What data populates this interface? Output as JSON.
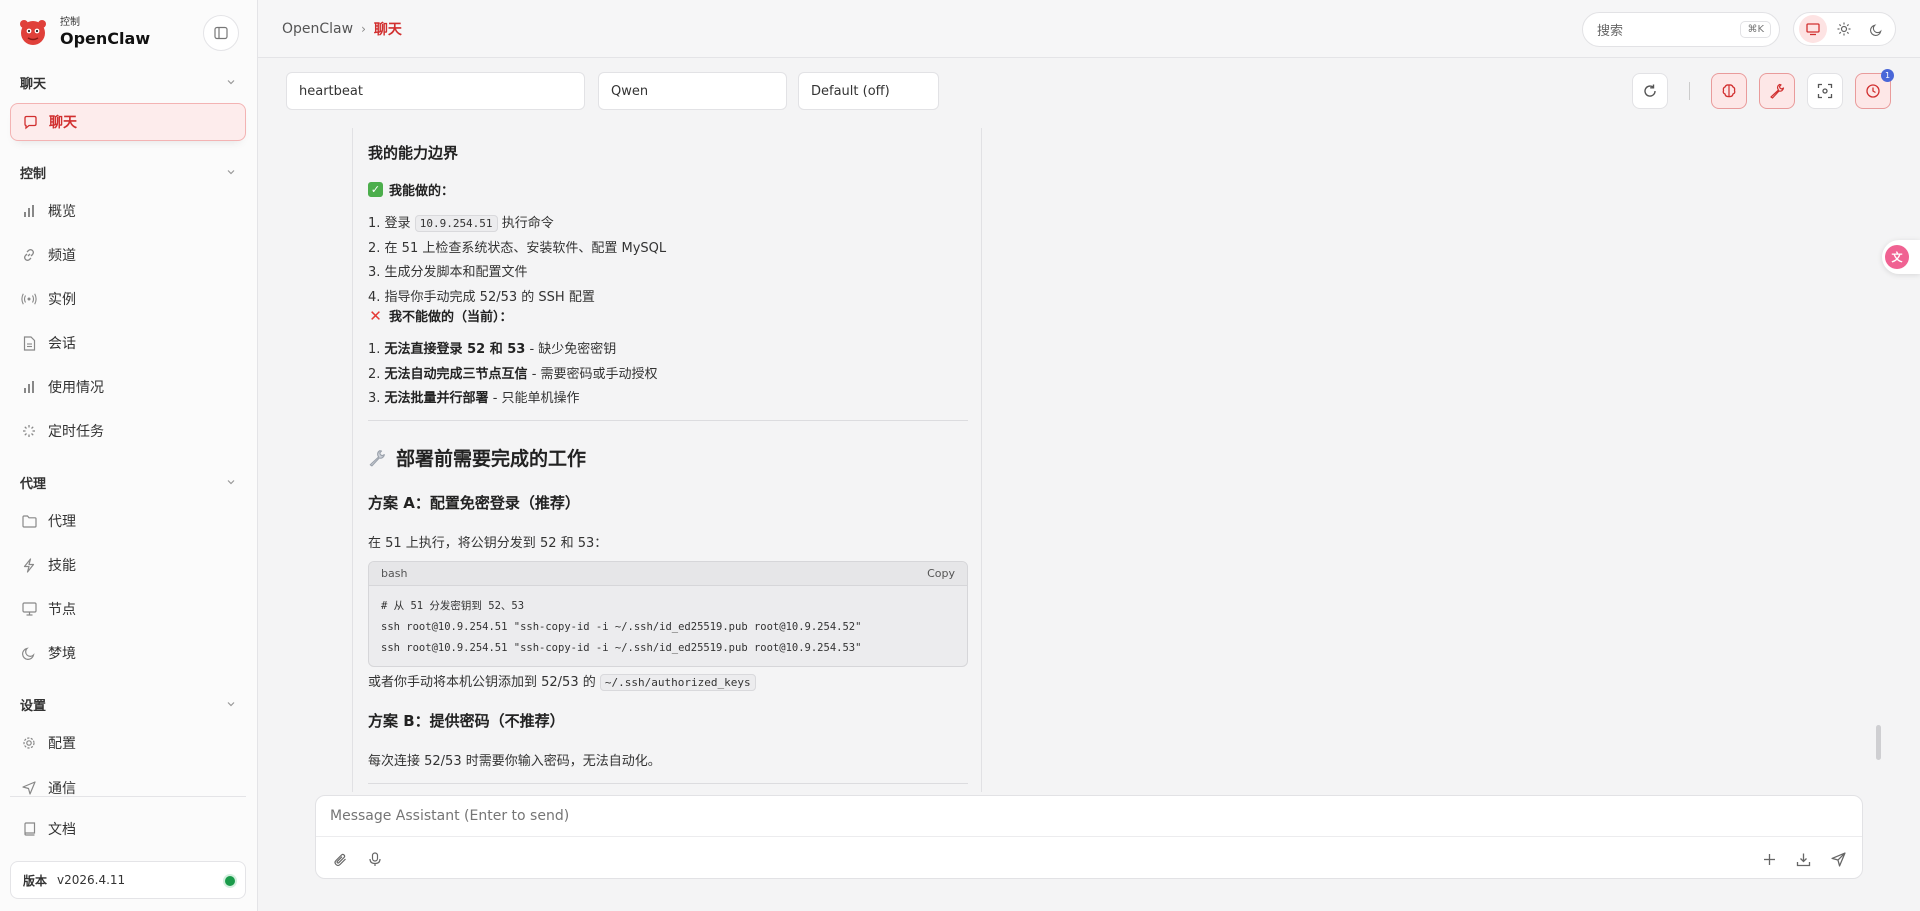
{
  "brand": {
    "subtitle": "控制",
    "name": "OpenClaw"
  },
  "sidebar": {
    "sections": [
      {
        "label": "聊天"
      },
      {
        "label": "控制"
      },
      {
        "label": "代理"
      },
      {
        "label": "设置"
      }
    ],
    "items": [
      {
        "label": "聊天",
        "active": true
      },
      {
        "label": "概览"
      },
      {
        "label": "频道"
      },
      {
        "label": "实例"
      },
      {
        "label": "会话"
      },
      {
        "label": "使用情况"
      },
      {
        "label": "定时任务"
      },
      {
        "label": "代理"
      },
      {
        "label": "技能"
      },
      {
        "label": "节点"
      },
      {
        "label": "梦境"
      },
      {
        "label": "配置"
      },
      {
        "label": "通信"
      },
      {
        "label": "文档"
      }
    ],
    "version_label": "版本",
    "version_value": "v2026.4.11",
    "status_color": "#1a9b4a"
  },
  "header": {
    "breadcrumb_root": "OpenClaw",
    "breadcrumb_sep": "›",
    "breadcrumb_current": "聊天",
    "search_placeholder": "搜索",
    "search_shortcut": "⌘K",
    "theme_active": "system"
  },
  "toolbar": {
    "session_value": "heartbeat",
    "model_value": "Qwen",
    "thinking_value": "Default (off)",
    "badge_count": "1"
  },
  "message": {
    "h_capabilities": "我的能力边界",
    "can_title": "我能做的：",
    "can_items": [
      {
        "n": "1.",
        "pre": "登录",
        "code": "10.9.254.51",
        "post": "执行命令"
      },
      {
        "n": "2.",
        "text": "在 51 上检查系统状态、安装软件、配置 MySQL"
      },
      {
        "n": "3.",
        "text": "生成分发脚本和配置文件"
      },
      {
        "n": "4.",
        "text": "指导你手动完成 52/53 的 SSH 配置"
      }
    ],
    "cannot_title": "我不能做的（当前）：",
    "cannot_items": [
      {
        "n": "1.",
        "bold": "无法直接登录 52 和 53",
        "rest": " - 缺少免密密钥"
      },
      {
        "n": "2.",
        "bold": "无法自动完成三节点互信",
        "rest": " - 需要密码或手动授权"
      },
      {
        "n": "3.",
        "bold": "无法批量并行部署",
        "rest": " - 只能单机操作"
      }
    ],
    "h_prework": "部署前需要完成的工作",
    "plan_a": "方案 A：配置免密登录（推荐）",
    "plan_a_desc": "在 51 上执行，将公钥分发到 52 和 53：",
    "code_lang": "bash",
    "code_copy": "Copy",
    "code_lines": [
      "# 从 51 分发密钥到 52、53",
      "ssh root@10.9.254.51 \"ssh-copy-id -i ~/.ssh/id_ed25519.pub root@10.9.254.52\"",
      "ssh root@10.9.254.51 \"ssh-copy-id -i ~/.ssh/id_ed25519.pub root@10.9.254.53\""
    ],
    "alt_pre": "或者你手动将本机公钥添加到 52/53 的",
    "alt_code": "~/.ssh/authorized_keys",
    "plan_b": "方案 B：提供密码（不推荐）",
    "plan_b_desc": "每次连接 52/53 时需要你输入密码，无法自动化。"
  },
  "composer": {
    "placeholder": "Message Assistant (Enter to send)"
  },
  "colors": {
    "accent": "#d12f2f",
    "accent_bg": "#fdecec",
    "info_badge": "#4a67d8"
  }
}
